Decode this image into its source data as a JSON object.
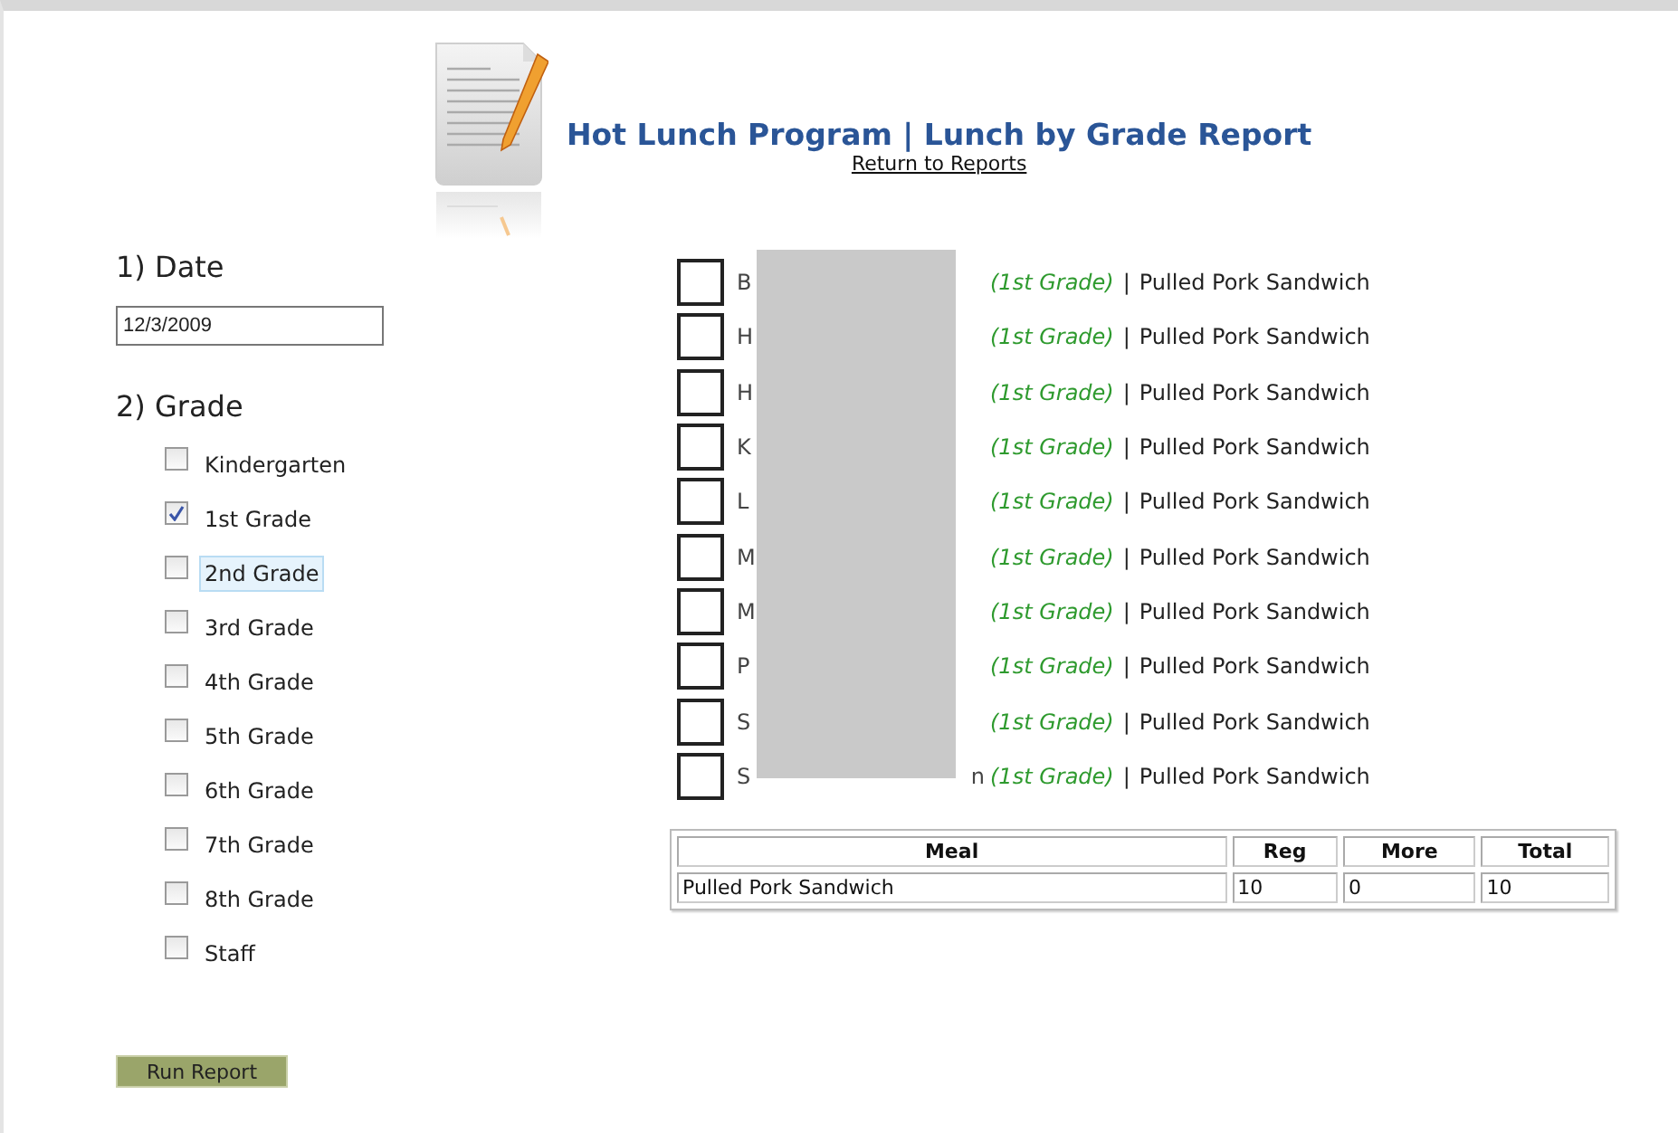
{
  "header": {
    "title": "Hot Lunch Program | Lunch by Grade Report",
    "link": "Return to Reports"
  },
  "date_section": {
    "heading": "1) Date",
    "value": "12/3/2009"
  },
  "grade_section": {
    "heading": "2) Grade",
    "options": [
      {
        "label": "Kindergarten",
        "checked": false,
        "highlighted": false
      },
      {
        "label": "1st Grade",
        "checked": true,
        "highlighted": false
      },
      {
        "label": "2nd Grade",
        "checked": false,
        "highlighted": true
      },
      {
        "label": "3rd Grade",
        "checked": false,
        "highlighted": false
      },
      {
        "label": "4th Grade",
        "checked": false,
        "highlighted": false
      },
      {
        "label": "5th Grade",
        "checked": false,
        "highlighted": false
      },
      {
        "label": "6th Grade",
        "checked": false,
        "highlighted": false
      },
      {
        "label": "7th Grade",
        "checked": false,
        "highlighted": false
      },
      {
        "label": "8th Grade",
        "checked": false,
        "highlighted": false
      },
      {
        "label": "Staff",
        "checked": false,
        "highlighted": false
      }
    ]
  },
  "run_button": "Run Report",
  "students": [
    {
      "name_start": "B",
      "checked": false,
      "grade": "(1st Grade)",
      "separator": "|",
      "meal": "Pulled Pork Sandwich"
    },
    {
      "name_start": "H",
      "checked": false,
      "grade": "(1st Grade)",
      "separator": "|",
      "meal": "Pulled Pork Sandwich"
    },
    {
      "name_start": "H",
      "checked": false,
      "grade": "(1st Grade)",
      "separator": "|",
      "meal": "Pulled Pork Sandwich"
    },
    {
      "name_start": "K",
      "checked": false,
      "grade": "(1st Grade)",
      "separator": "|",
      "meal": "Pulled Pork Sandwich"
    },
    {
      "name_start": "L",
      "checked": false,
      "grade": "(1st Grade)",
      "separator": "|",
      "meal": "Pulled Pork Sandwich"
    },
    {
      "name_start": "M",
      "checked": false,
      "grade": "(1st Grade)",
      "separator": "|",
      "meal": "Pulled Pork Sandwich"
    },
    {
      "name_start": "M",
      "checked": false,
      "grade": "(1st Grade)",
      "separator": "|",
      "meal": "Pulled Pork Sandwich"
    },
    {
      "name_start": "P",
      "checked": false,
      "grade": "(1st Grade)",
      "separator": "|",
      "meal": "Pulled Pork Sandwich"
    },
    {
      "name_start": "S",
      "checked": false,
      "grade": "(1st Grade)",
      "separator": "|",
      "meal": "Pulled Pork Sandwich"
    },
    {
      "name_start": "S",
      "checked": false,
      "name_end": "n",
      "grade": "(1st Grade)",
      "separator": "|",
      "meal": "Pulled Pork Sandwich"
    }
  ],
  "summary_table": {
    "columns": [
      "Meal",
      "Reg",
      "More",
      "Total"
    ],
    "rows": [
      [
        "Pulled Pork Sandwich",
        "10",
        "0",
        "10"
      ]
    ]
  }
}
